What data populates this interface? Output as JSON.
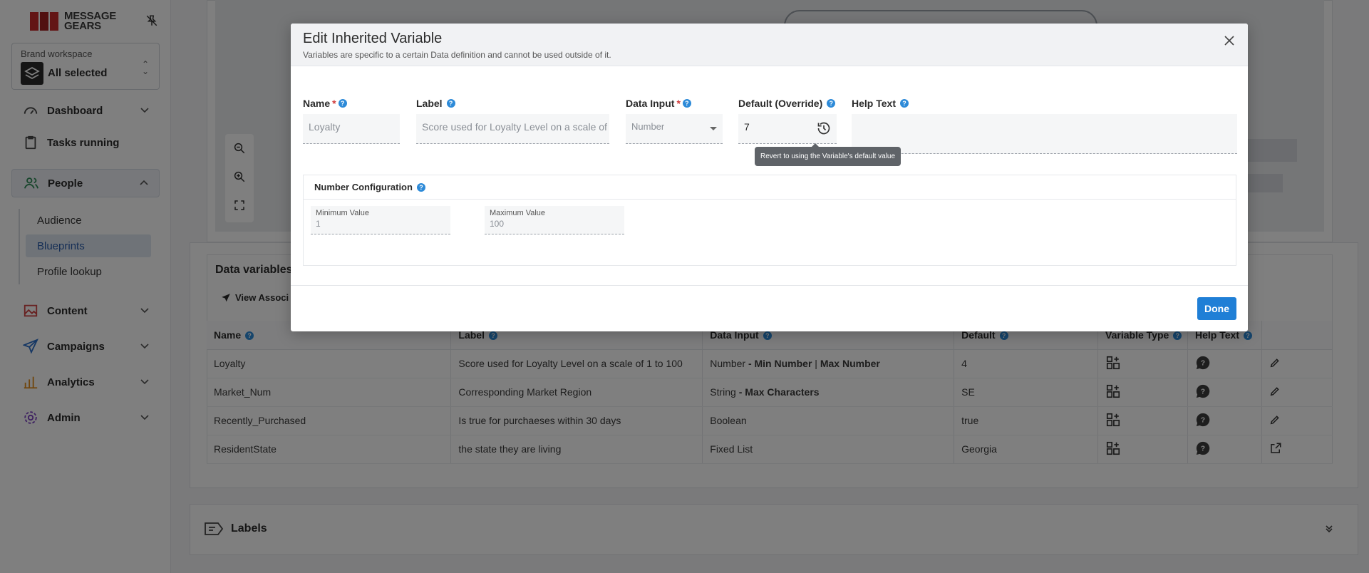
{
  "brand": {
    "logo_line1": "MESSAGE",
    "logo_line2": "GEARS",
    "accent": "#c62a2a"
  },
  "workspace": {
    "caption": "Brand workspace",
    "value": "All selected"
  },
  "nav": {
    "dashboard": "Dashboard",
    "tasks": "Tasks running",
    "people": "People",
    "people_sub": [
      "Audience",
      "Blueprints",
      "Profile lookup"
    ],
    "content": "Content",
    "campaigns": "Campaigns",
    "analytics": "Analytics",
    "admin": "Admin"
  },
  "data_variables": {
    "title": "Data variables (",
    "view_assoc": "View Associ",
    "columns": [
      "Name",
      "Label",
      "Data Input",
      "Default",
      "Variable Type",
      "Help Text",
      ""
    ],
    "rows": [
      {
        "name": "Loyalty",
        "label": "Score used for Loyalty Level on a scale of 1 to 100",
        "input": "Number",
        "input_extra1": " - Min Number",
        "sep": " | ",
        "input_extra2": "Max Number",
        "default": "4",
        "action": "edit"
      },
      {
        "name": "Market_Num",
        "label": "Corresponding Market Region",
        "input": "String",
        "input_extra1": " - Max Characters",
        "sep": "",
        "input_extra2": "",
        "default": "SE",
        "action": "edit"
      },
      {
        "name": "Recently_Purchased",
        "label": "Is true for purchaeses within 30 days",
        "input": "Boolean",
        "input_extra1": "",
        "sep": "",
        "input_extra2": "",
        "default": "true",
        "action": "edit"
      },
      {
        "name": "ResidentState",
        "label": "the state they are living",
        "input": "Fixed List",
        "input_extra1": "",
        "sep": "",
        "input_extra2": "",
        "default": "Georgia",
        "action": "open"
      }
    ]
  },
  "labels_section": {
    "title": "Labels"
  },
  "modal": {
    "title": "Edit Inherited Variable",
    "subtitle": "Variables are specific to a certain Data definition and cannot be used outside of it.",
    "fields": {
      "name_label": "Name",
      "name_value": "Loyalty",
      "label_label": "Label",
      "label_value": "Score used for Loyalty Level on a scale of 1 to 100",
      "data_input_label": "Data Input",
      "data_input_value": "Number",
      "default_label": "Default (Override)",
      "default_value": "7",
      "help_text_label": "Help Text",
      "help_text_value": ""
    },
    "tooltip": "Revert to using the Variable's default value",
    "number_config": {
      "title": "Number Configuration",
      "min_caption": "Minimum Value",
      "min_value": "1",
      "max_caption": "Maximum Value",
      "max_value": "100"
    },
    "done_label": "Done"
  },
  "colors": {
    "primary": "#1f7fd6",
    "help_icon": "#2d8ad8",
    "required": "#d03b3b"
  }
}
